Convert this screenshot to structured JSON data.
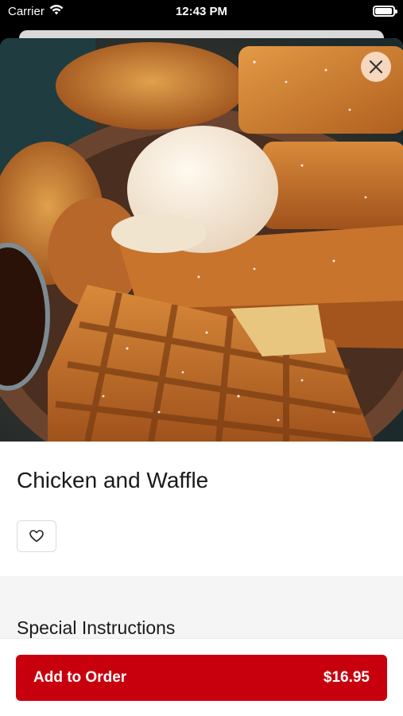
{
  "status_bar": {
    "carrier": "Carrier",
    "time": "12:43 PM",
    "wifi_icon": "wifi-icon",
    "battery_icon": "battery-icon"
  },
  "item": {
    "image": "chicken-and-waffle-photo",
    "name": "Chicken and Waffle",
    "favorite_icon": "heart-icon",
    "close_icon": "close-icon"
  },
  "special_instructions": {
    "title": "Special Instructions"
  },
  "order_button": {
    "label": "Add to Order",
    "price": "$16.95"
  },
  "colors": {
    "accent": "#c8000d",
    "section_bg": "#f5f5f5"
  }
}
